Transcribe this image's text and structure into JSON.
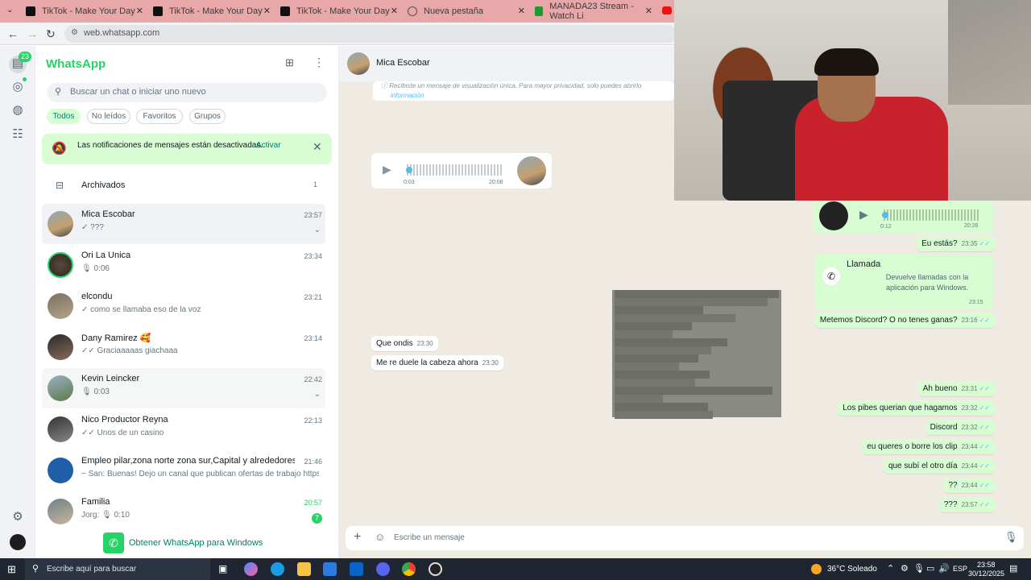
{
  "browser": {
    "tabs": [
      {
        "title": "TikTok - Make Your Day"
      },
      {
        "title": "TikTok - Make Your Day"
      },
      {
        "title": "TikTok - Make Your Day"
      },
      {
        "title": "Nueva pestaña"
      },
      {
        "title": "MANADA23 Stream - Watch Li"
      }
    ],
    "url": "web.whatsapp.com"
  },
  "rail": {
    "chats_badge": "23"
  },
  "sidebar": {
    "app_title": "WhatsApp",
    "search_placeholder": "Buscar un chat o iniciar uno nuevo",
    "filters": [
      "Todos",
      "No leídos",
      "Favoritos",
      "Grupos"
    ],
    "notification": {
      "text": "Las notificaciones de mensajes están desactivadas.",
      "action": "Activar"
    },
    "archived": {
      "label": "Archivados",
      "count": "1"
    },
    "chats": [
      {
        "name": "Mica Escobar",
        "preview": "✓ ???",
        "time": "23:57"
      },
      {
        "name": "Ori La Unica",
        "preview": "🎙 0:06",
        "time": "23:34"
      },
      {
        "name": "elcondu",
        "preview": "✓ como se llamaba eso de la voz",
        "time": "23:21"
      },
      {
        "name": "Dany Ramirez 🥰",
        "preview": "✓✓ Graciaaaaas giachaaa",
        "time": "23:14"
      },
      {
        "name": "Kevin Leincker",
        "preview": "🎙 0:03",
        "time": "22:42"
      },
      {
        "name": "Nico Productor Reyna",
        "preview": "✓✓ Unos de un casino",
        "time": "22:13"
      },
      {
        "name": "Empleo pilar,zona norte zona sur,Capital y alrededores ...",
        "preview": "~ San: Buenas! Dejo un canal que publican ofertas de trabajo https://...",
        "time": "21:46"
      },
      {
        "name": "Familia",
        "preview": "Jorg: 🎙 0:10",
        "time": "20:57",
        "unread": "7"
      }
    ],
    "get_app": "Obtener WhatsApp para Windows"
  },
  "conversation": {
    "contact": "Mica Escobar",
    "view_once_notice": "Recibiste un mensaje de visualización única. Para mayor privacidad, solo puedes abrirlo",
    "view_once_link": "información",
    "voice_in": {
      "current": "0:03",
      "duration": "20:08"
    },
    "voice_out": {
      "duration": "0:12",
      "time": "20:26"
    },
    "messages_in": [
      {
        "text": "Que ondis",
        "time": "23:30"
      },
      {
        "text": "Me re duele la cabeza ahora",
        "time": "23:30"
      }
    ],
    "call_card": {
      "title": "Llamada",
      "body": "Devuelve llamadas con la aplicación para Windows.",
      "time": "23:15"
    },
    "messages_out": [
      {
        "text": "Eu estás?",
        "time": "23:35"
      },
      {
        "text": "Metemos Discord? O no tenes ganas?",
        "time": "23:16"
      },
      {
        "text": "Ah bueno",
        "time": "23:31"
      },
      {
        "text": "Los pibes querian que hagamos",
        "time": "23:32"
      },
      {
        "text": "Discord",
        "time": "23:32"
      },
      {
        "text": "eu queres o borre los clip",
        "time": "23:44"
      },
      {
        "text": "que subí el otro día",
        "time": "23:44"
      },
      {
        "text": "??",
        "time": "23:44"
      },
      {
        "text": "???",
        "time": "23:57"
      }
    ],
    "composer_placeholder": "Escribe un mensaje"
  },
  "taskbar": {
    "search_placeholder": "Escribe aquí para buscar",
    "weather": "36°C Soleado",
    "language": "ESP",
    "time": "23:58",
    "date": "30/12/2025"
  },
  "colors": {
    "whatsapp_green": "#25d366",
    "tab_strip": "#e8a7a8",
    "outgoing_bubble": "#d9fdd3",
    "chat_background": "#efeae2"
  }
}
